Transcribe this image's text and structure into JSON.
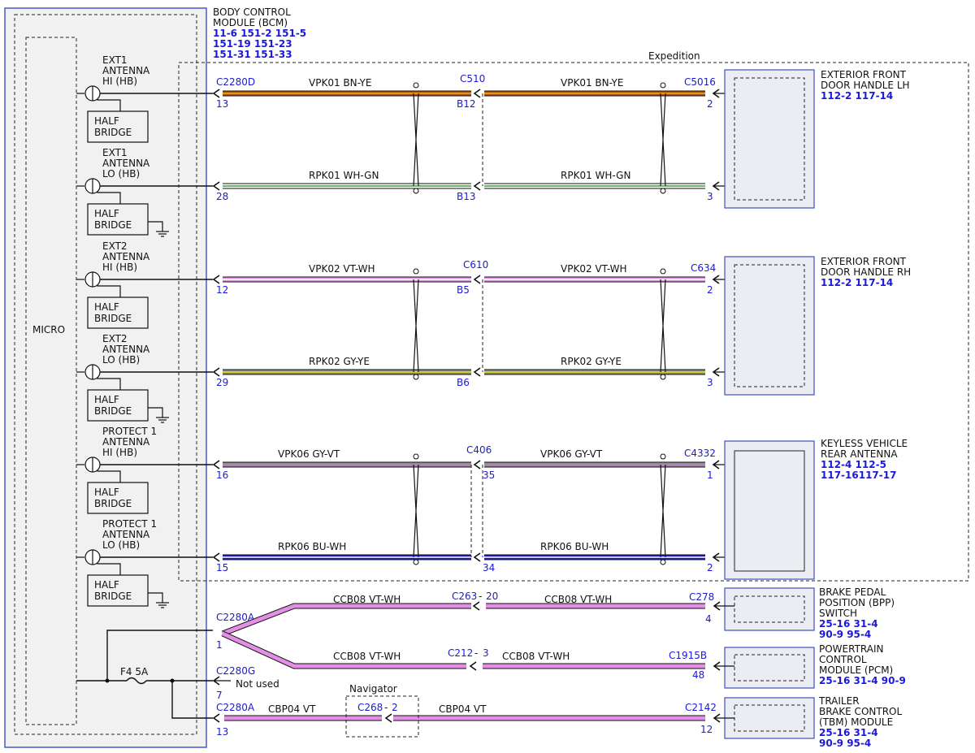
{
  "bcm": {
    "title": [
      "BODY CONTROL",
      "MODULE (BCM)"
    ],
    "refs": [
      "11-6  151-2  151-5",
      "151-19  151-23",
      "151-31  151-33"
    ],
    "micro_label": "MICRO",
    "half_bridge": [
      "HALF",
      "BRIDGE"
    ],
    "fuse_label": "F4    5A",
    "not_used": "Not used"
  },
  "expedition_label": "Expedition",
  "navigator_label": "Navigator",
  "colors": {
    "blue_text": "#1a1ad8",
    "module_fill": "#ecedf2",
    "bcm_fill": "#f1f1f1",
    "module_border": "#3d4fc4"
  },
  "antenna_groups": [
    {
      "label": [
        "EXT1",
        "ANTENNA",
        "HI (HB)"
      ],
      "ground": false
    },
    {
      "label": [
        "EXT1",
        "ANTENNA",
        "LO (HB)"
      ],
      "ground": true
    },
    {
      "label": [
        "EXT2",
        "ANTENNA",
        "HI (HB)"
      ],
      "ground": false
    },
    {
      "label": [
        "EXT2",
        "ANTENNA",
        "LO (HB)"
      ],
      "ground": true
    },
    {
      "label": [
        "PROTECT 1",
        "ANTENNA",
        "HI (HB)"
      ],
      "ground": false
    },
    {
      "label": [
        "PROTECT 1",
        "ANTENNA",
        "LO (HB)"
      ],
      "ground": true
    }
  ],
  "wires": [
    {
      "left_conn": "C2280D",
      "left_pin": "13",
      "left_label": "VPK01   BN-YE",
      "mid_conn": "C510",
      "mid_pin": "B12",
      "right_label": "VPK01   BN-YE",
      "right_conn": "C5016",
      "right_pin": "2",
      "main": "#b34f1d",
      "stripe": "#f0b000"
    },
    {
      "left_conn": "",
      "left_pin": "28",
      "left_label": "RPK01   WH-GN",
      "mid_conn": "",
      "mid_pin": "B13",
      "right_label": "RPK01   WH-GN",
      "right_conn": "",
      "right_pin": "3",
      "main": "#ffffff",
      "stripe": "#3aa13a"
    },
    {
      "left_conn": "",
      "left_pin": "12",
      "left_label": "VPK02   VT-WH",
      "mid_conn": "C610",
      "mid_pin": "B5",
      "right_label": "VPK02   VT-WH",
      "right_conn": "C634",
      "right_pin": "2",
      "main": "#e28fe5",
      "stripe": "#ffffff"
    },
    {
      "left_conn": "",
      "left_pin": "29",
      "left_label": "RPK02   GY-YE",
      "mid_conn": "",
      "mid_pin": "B6",
      "right_label": "RPK02   GY-YE",
      "right_conn": "",
      "right_pin": "3",
      "main": "#8a8a8a",
      "stripe": "#e8e000"
    },
    {
      "left_conn": "",
      "left_pin": "16",
      "left_label": "VPK06   GY-VT",
      "mid_conn": "C406",
      "mid_pin": "35",
      "right_label": "VPK06   GY-VT",
      "right_conn": "C4332",
      "right_pin": "1",
      "main": "#8e8e8e",
      "stripe": "#c77ad1"
    },
    {
      "left_conn": "",
      "left_pin": "15",
      "left_label": "RPK06   BU-WH",
      "mid_conn": "",
      "mid_pin": "34",
      "right_label": "RPK06   BU-WH",
      "right_conn": "",
      "right_pin": "2",
      "main": "#1c1cc8",
      "stripe": "#ffffff"
    }
  ],
  "modules": [
    {
      "title": [
        "EXTERIOR FRONT",
        "DOOR HANDLE LH"
      ],
      "refs": [
        "112-2  117-14"
      ]
    },
    {
      "title": [
        "EXTERIOR FRONT",
        "DOOR HANDLE RH"
      ],
      "refs": [
        "112-2  117-14"
      ]
    },
    {
      "title": [
        "KEYLESS VEHICLE",
        "REAR ANTENNA"
      ],
      "refs": [
        "112-4 112-5",
        "117-16117-17"
      ]
    },
    {
      "title": [
        "BRAKE PEDAL",
        "POSITION (BPP)",
        "SWITCH"
      ],
      "refs": [
        "25-16 31-4",
        "90-9  95-4"
      ]
    },
    {
      "title": [
        "POWERTRAIN",
        "CONTROL",
        "MODULE (PCM)"
      ],
      "refs": [
        "25-16  31-4   90-9"
      ]
    },
    {
      "title": [
        "TRAILER",
        "BRAKE CONTROL",
        "(TBM) MODULE"
      ],
      "refs": [
        "25-16 31-4",
        "90-9  95-4"
      ]
    }
  ],
  "power": {
    "c2280a_top": "C2280A",
    "c2280a_top_pin": "1",
    "c2280g": "C2280G",
    "c2280g_pin": "7",
    "c2280a_bot": "C2280A",
    "c2280a_bot_pin": "13",
    "ccb_upper_left": "CCB08   VT-WH",
    "c263": "C263",
    "c263_pin": "20",
    "ccb_upper_right": "CCB08   VT-WH",
    "c278": "C278",
    "c278_pin": "4",
    "ccb_lower_left": "CCB08   VT-WH",
    "c212": "C212",
    "c212_pin": "3",
    "ccb_lower_right": "CCB08   VT-WH",
    "c1915b": "C1915B",
    "c1915b_pin": "48",
    "cbp_left": "CBP04   VT",
    "c268": "C268",
    "c268_pin": "2",
    "cbp_right": "CBP04   VT",
    "c2142": "C2142",
    "c2142_pin": "12",
    "wire_color": "#e28fe5"
  }
}
